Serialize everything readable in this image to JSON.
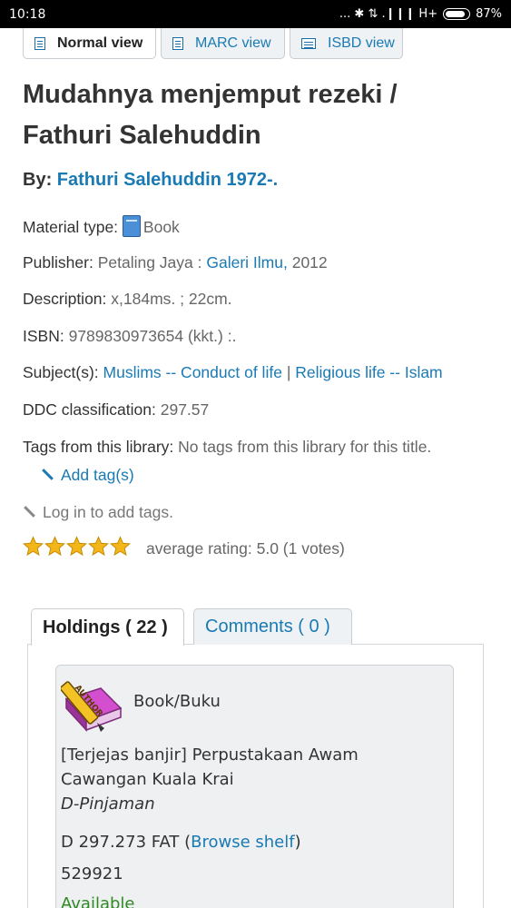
{
  "status_bar": {
    "time": "10:18",
    "indicators": "... ✱ ⇅ .❙❙❙ H+",
    "battery": "87%",
    "battery_level": 0.87
  },
  "view_tabs": [
    {
      "label": "Normal view",
      "active": true
    },
    {
      "label": "MARC view",
      "active": false
    },
    {
      "label": "ISBD view",
      "active": false
    }
  ],
  "record": {
    "title_line1": "Mudahnya menjemput rezeki /",
    "title_line2": "Fathuri Salehuddin",
    "by_label": "By:",
    "author": "Fathuri Salehuddin 1972-.",
    "material_type_label": "Material type:",
    "material_type": "Book",
    "publisher_label": "Publisher:",
    "publisher_place": "Petaling Jaya :",
    "publisher_name": "Galeri Ilmu,",
    "publisher_year": "2012",
    "description_label": "Description:",
    "description": "x,184ms. ; 22cm.",
    "isbn_label": "ISBN:",
    "isbn": "9789830973654 (kkt.) :.",
    "subjects_label": "Subject(s):",
    "subject1": "Muslims -- Conduct of life",
    "subject_separator": "|",
    "subject2": "Religious life -- Islam",
    "ddc_label": "DDC classification:",
    "ddc": "297.57",
    "tags_label": "Tags from this library:",
    "tags_value": "No tags from this library for this title.",
    "add_tags": "Add tag(s)",
    "login_tags": "Log in to add tags.",
    "rating_text": "average rating: 5.0 (1 votes)",
    "rating_stars": 5
  },
  "holdings_tabs": [
    {
      "label": "Holdings ( 22 )",
      "active": true
    },
    {
      "label": "Comments ( 0 )",
      "active": false
    }
  ],
  "holding_item": {
    "item_type": "Book/Buku",
    "location_line1": "[Terjejas banjir] Perpustakaan Awam",
    "location_line2": "Cawangan Kuala Krai",
    "collection": "D-Pinjaman",
    "call_number": "D 297.273 FAT (",
    "browse_shelf": "Browse shelf",
    "call_number_end": ")",
    "barcode": "529921",
    "status": "Available",
    "status_color": "#2e8b22"
  },
  "colors": {
    "link": "#1a7ab3",
    "star": "#f3b61a"
  }
}
